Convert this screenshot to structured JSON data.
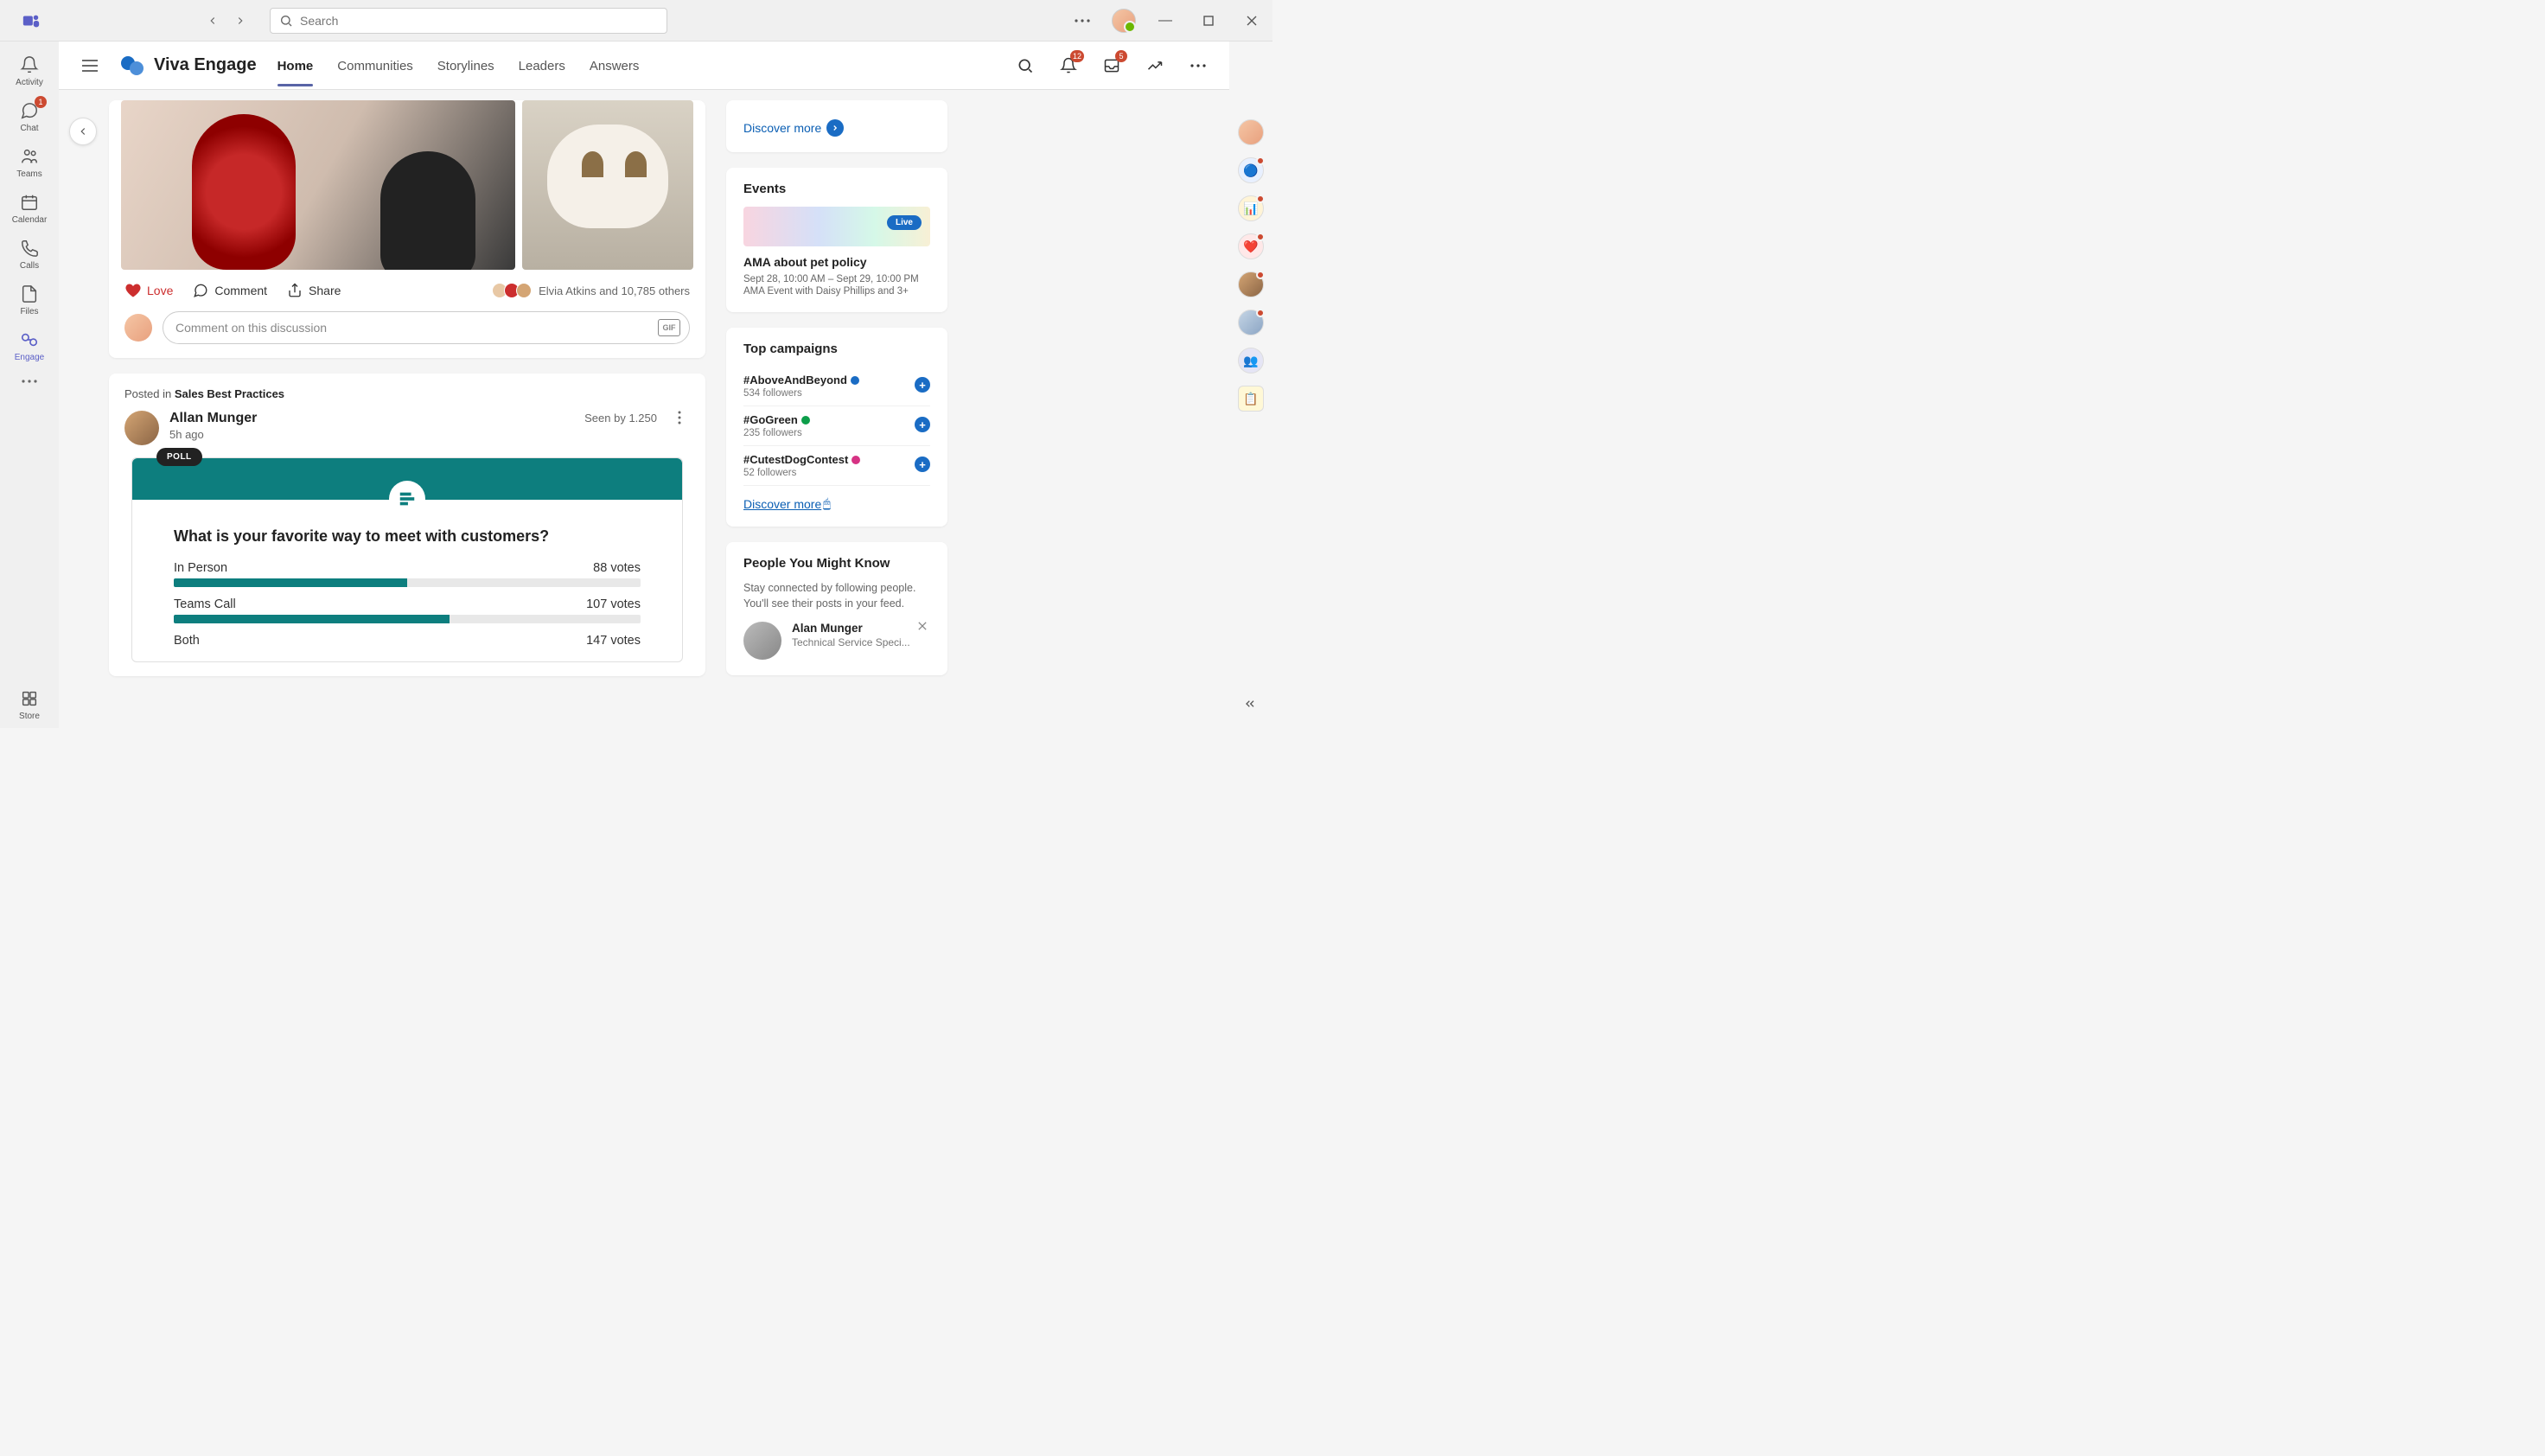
{
  "titlebar": {
    "search_placeholder": "Search"
  },
  "rail": {
    "activity": "Activity",
    "chat": "Chat",
    "chat_badge": "1",
    "teams": "Teams",
    "calendar": "Calendar",
    "calls": "Calls",
    "files": "Files",
    "engage": "Engage",
    "store": "Store"
  },
  "header": {
    "app_title": "Viva Engage",
    "tabs": {
      "home": "Home",
      "communities": "Communities",
      "storylines": "Storylines",
      "leaders": "Leaders",
      "answers": "Answers"
    },
    "notif_badge": "12",
    "inbox_badge": "5"
  },
  "post1": {
    "love_label": "Love",
    "comment_label": "Comment",
    "share_label": "Share",
    "reactions_summary": "Elvia Atkins and 10,785 others",
    "comment_placeholder": "Comment on this discussion",
    "gif": "GIF"
  },
  "post2": {
    "posted_in_prefix": "Posted in ",
    "posted_in_community": "Sales Best Practices",
    "author": "Allan Munger",
    "time": "5h ago",
    "seen_by": "Seen by 1.250",
    "poll": {
      "badge": "POLL",
      "question": "What is your favorite way to meet with customers?",
      "options": [
        {
          "label": "In Person",
          "votes": "88 votes",
          "pct": 50
        },
        {
          "label": "Teams Call",
          "votes": "107 votes",
          "pct": 59
        },
        {
          "label": "Both",
          "votes": "147 votes",
          "pct": 0
        }
      ]
    }
  },
  "side": {
    "discover_more": "Discover more",
    "events_title": "Events",
    "event": {
      "live": "Live",
      "title": "AMA about pet policy",
      "time": "Sept 28, 10:00 AM – Sept 29, 10:00 PM",
      "sub": "AMA Event with Daisy Phillips and 3+"
    },
    "campaigns_title": "Top campaigns",
    "campaigns": [
      {
        "tag": "#AboveAndBeyond",
        "followers": "534 followers",
        "color": "#1a6cc4"
      },
      {
        "tag": "#GoGreen",
        "followers": "235 followers",
        "color": "#0d9e4a"
      },
      {
        "tag": "#CutestDogContest",
        "followers": "52 followers",
        "color": "#d63384"
      }
    ],
    "pymk_title": "People You Might Know",
    "pymk_desc": "Stay connected by following people. You'll see their posts in your feed.",
    "person": {
      "name": "Alan Munger",
      "role": "Technical Service Speci..."
    }
  }
}
